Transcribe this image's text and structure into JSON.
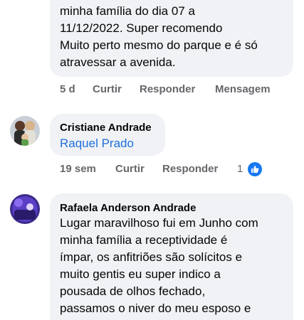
{
  "comment1": {
    "text_lines": [
      "minha família do dia 07 a",
      "11/12/2022. Super recomendo",
      "Muito perto mesmo do parque e é só",
      "atravessar a avenida."
    ],
    "time": "5 d",
    "like_label": "Curtir",
    "reply_label": "Responder",
    "message_label": "Mensagem"
  },
  "comment2": {
    "author": "Cristiane Andrade",
    "mention": "Raquel Prado",
    "time": "19 sem",
    "like_label": "Curtir",
    "reply_label": "Responder",
    "reaction_count": "1"
  },
  "comment3": {
    "author": "Rafaela Anderson Andrade",
    "text_lines": [
      "Lugar maravilhoso fui em Junho com",
      "minha família a receptividade é",
      "ímpar, os anfitriões são solícitos e",
      "muito gentis eu super indico a",
      "pousada de olhos fechado,",
      "passamos o niver do meu esposo e"
    ]
  },
  "icons": {
    "reaction": "like-icon",
    "avatar1": "avatar-cristiane",
    "avatar2": "avatar-rafaela"
  },
  "colors": {
    "bubble": "#f0f2f5",
    "meta": "#65676b",
    "mention": "#216fdb",
    "like": "#1877f2"
  }
}
